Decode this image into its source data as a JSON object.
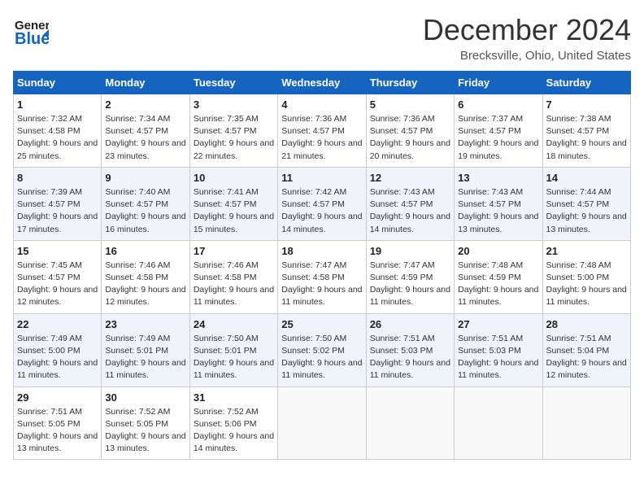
{
  "header": {
    "logo_general": "General",
    "logo_blue": "Blue",
    "title": "December 2024",
    "location": "Brecksville, Ohio, United States"
  },
  "days_of_week": [
    "Sunday",
    "Monday",
    "Tuesday",
    "Wednesday",
    "Thursday",
    "Friday",
    "Saturday"
  ],
  "weeks": [
    [
      {
        "day": "1",
        "sunrise": "Sunrise: 7:32 AM",
        "sunset": "Sunset: 4:58 PM",
        "daylight": "Daylight: 9 hours and 25 minutes."
      },
      {
        "day": "2",
        "sunrise": "Sunrise: 7:34 AM",
        "sunset": "Sunset: 4:57 PM",
        "daylight": "Daylight: 9 hours and 23 minutes."
      },
      {
        "day": "3",
        "sunrise": "Sunrise: 7:35 AM",
        "sunset": "Sunset: 4:57 PM",
        "daylight": "Daylight: 9 hours and 22 minutes."
      },
      {
        "day": "4",
        "sunrise": "Sunrise: 7:36 AM",
        "sunset": "Sunset: 4:57 PM",
        "daylight": "Daylight: 9 hours and 21 minutes."
      },
      {
        "day": "5",
        "sunrise": "Sunrise: 7:36 AM",
        "sunset": "Sunset: 4:57 PM",
        "daylight": "Daylight: 9 hours and 20 minutes."
      },
      {
        "day": "6",
        "sunrise": "Sunrise: 7:37 AM",
        "sunset": "Sunset: 4:57 PM",
        "daylight": "Daylight: 9 hours and 19 minutes."
      },
      {
        "day": "7",
        "sunrise": "Sunrise: 7:38 AM",
        "sunset": "Sunset: 4:57 PM",
        "daylight": "Daylight: 9 hours and 18 minutes."
      }
    ],
    [
      {
        "day": "8",
        "sunrise": "Sunrise: 7:39 AM",
        "sunset": "Sunset: 4:57 PM",
        "daylight": "Daylight: 9 hours and 17 minutes."
      },
      {
        "day": "9",
        "sunrise": "Sunrise: 7:40 AM",
        "sunset": "Sunset: 4:57 PM",
        "daylight": "Daylight: 9 hours and 16 minutes."
      },
      {
        "day": "10",
        "sunrise": "Sunrise: 7:41 AM",
        "sunset": "Sunset: 4:57 PM",
        "daylight": "Daylight: 9 hours and 15 minutes."
      },
      {
        "day": "11",
        "sunrise": "Sunrise: 7:42 AM",
        "sunset": "Sunset: 4:57 PM",
        "daylight": "Daylight: 9 hours and 14 minutes."
      },
      {
        "day": "12",
        "sunrise": "Sunrise: 7:43 AM",
        "sunset": "Sunset: 4:57 PM",
        "daylight": "Daylight: 9 hours and 14 minutes."
      },
      {
        "day": "13",
        "sunrise": "Sunrise: 7:43 AM",
        "sunset": "Sunset: 4:57 PM",
        "daylight": "Daylight: 9 hours and 13 minutes."
      },
      {
        "day": "14",
        "sunrise": "Sunrise: 7:44 AM",
        "sunset": "Sunset: 4:57 PM",
        "daylight": "Daylight: 9 hours and 13 minutes."
      }
    ],
    [
      {
        "day": "15",
        "sunrise": "Sunrise: 7:45 AM",
        "sunset": "Sunset: 4:57 PM",
        "daylight": "Daylight: 9 hours and 12 minutes."
      },
      {
        "day": "16",
        "sunrise": "Sunrise: 7:46 AM",
        "sunset": "Sunset: 4:58 PM",
        "daylight": "Daylight: 9 hours and 12 minutes."
      },
      {
        "day": "17",
        "sunrise": "Sunrise: 7:46 AM",
        "sunset": "Sunset: 4:58 PM",
        "daylight": "Daylight: 9 hours and 11 minutes."
      },
      {
        "day": "18",
        "sunrise": "Sunrise: 7:47 AM",
        "sunset": "Sunset: 4:58 PM",
        "daylight": "Daylight: 9 hours and 11 minutes."
      },
      {
        "day": "19",
        "sunrise": "Sunrise: 7:47 AM",
        "sunset": "Sunset: 4:59 PM",
        "daylight": "Daylight: 9 hours and 11 minutes."
      },
      {
        "day": "20",
        "sunrise": "Sunrise: 7:48 AM",
        "sunset": "Sunset: 4:59 PM",
        "daylight": "Daylight: 9 hours and 11 minutes."
      },
      {
        "day": "21",
        "sunrise": "Sunrise: 7:48 AM",
        "sunset": "Sunset: 5:00 PM",
        "daylight": "Daylight: 9 hours and 11 minutes."
      }
    ],
    [
      {
        "day": "22",
        "sunrise": "Sunrise: 7:49 AM",
        "sunset": "Sunset: 5:00 PM",
        "daylight": "Daylight: 9 hours and 11 minutes."
      },
      {
        "day": "23",
        "sunrise": "Sunrise: 7:49 AM",
        "sunset": "Sunset: 5:01 PM",
        "daylight": "Daylight: 9 hours and 11 minutes."
      },
      {
        "day": "24",
        "sunrise": "Sunrise: 7:50 AM",
        "sunset": "Sunset: 5:01 PM",
        "daylight": "Daylight: 9 hours and 11 minutes."
      },
      {
        "day": "25",
        "sunrise": "Sunrise: 7:50 AM",
        "sunset": "Sunset: 5:02 PM",
        "daylight": "Daylight: 9 hours and 11 minutes."
      },
      {
        "day": "26",
        "sunrise": "Sunrise: 7:51 AM",
        "sunset": "Sunset: 5:03 PM",
        "daylight": "Daylight: 9 hours and 11 minutes."
      },
      {
        "day": "27",
        "sunrise": "Sunrise: 7:51 AM",
        "sunset": "Sunset: 5:03 PM",
        "daylight": "Daylight: 9 hours and 11 minutes."
      },
      {
        "day": "28",
        "sunrise": "Sunrise: 7:51 AM",
        "sunset": "Sunset: 5:04 PM",
        "daylight": "Daylight: 9 hours and 12 minutes."
      }
    ],
    [
      {
        "day": "29",
        "sunrise": "Sunrise: 7:51 AM",
        "sunset": "Sunset: 5:05 PM",
        "daylight": "Daylight: 9 hours and 13 minutes."
      },
      {
        "day": "30",
        "sunrise": "Sunrise: 7:52 AM",
        "sunset": "Sunset: 5:05 PM",
        "daylight": "Daylight: 9 hours and 13 minutes."
      },
      {
        "day": "31",
        "sunrise": "Sunrise: 7:52 AM",
        "sunset": "Sunset: 5:06 PM",
        "daylight": "Daylight: 9 hours and 14 minutes."
      },
      null,
      null,
      null,
      null
    ]
  ]
}
